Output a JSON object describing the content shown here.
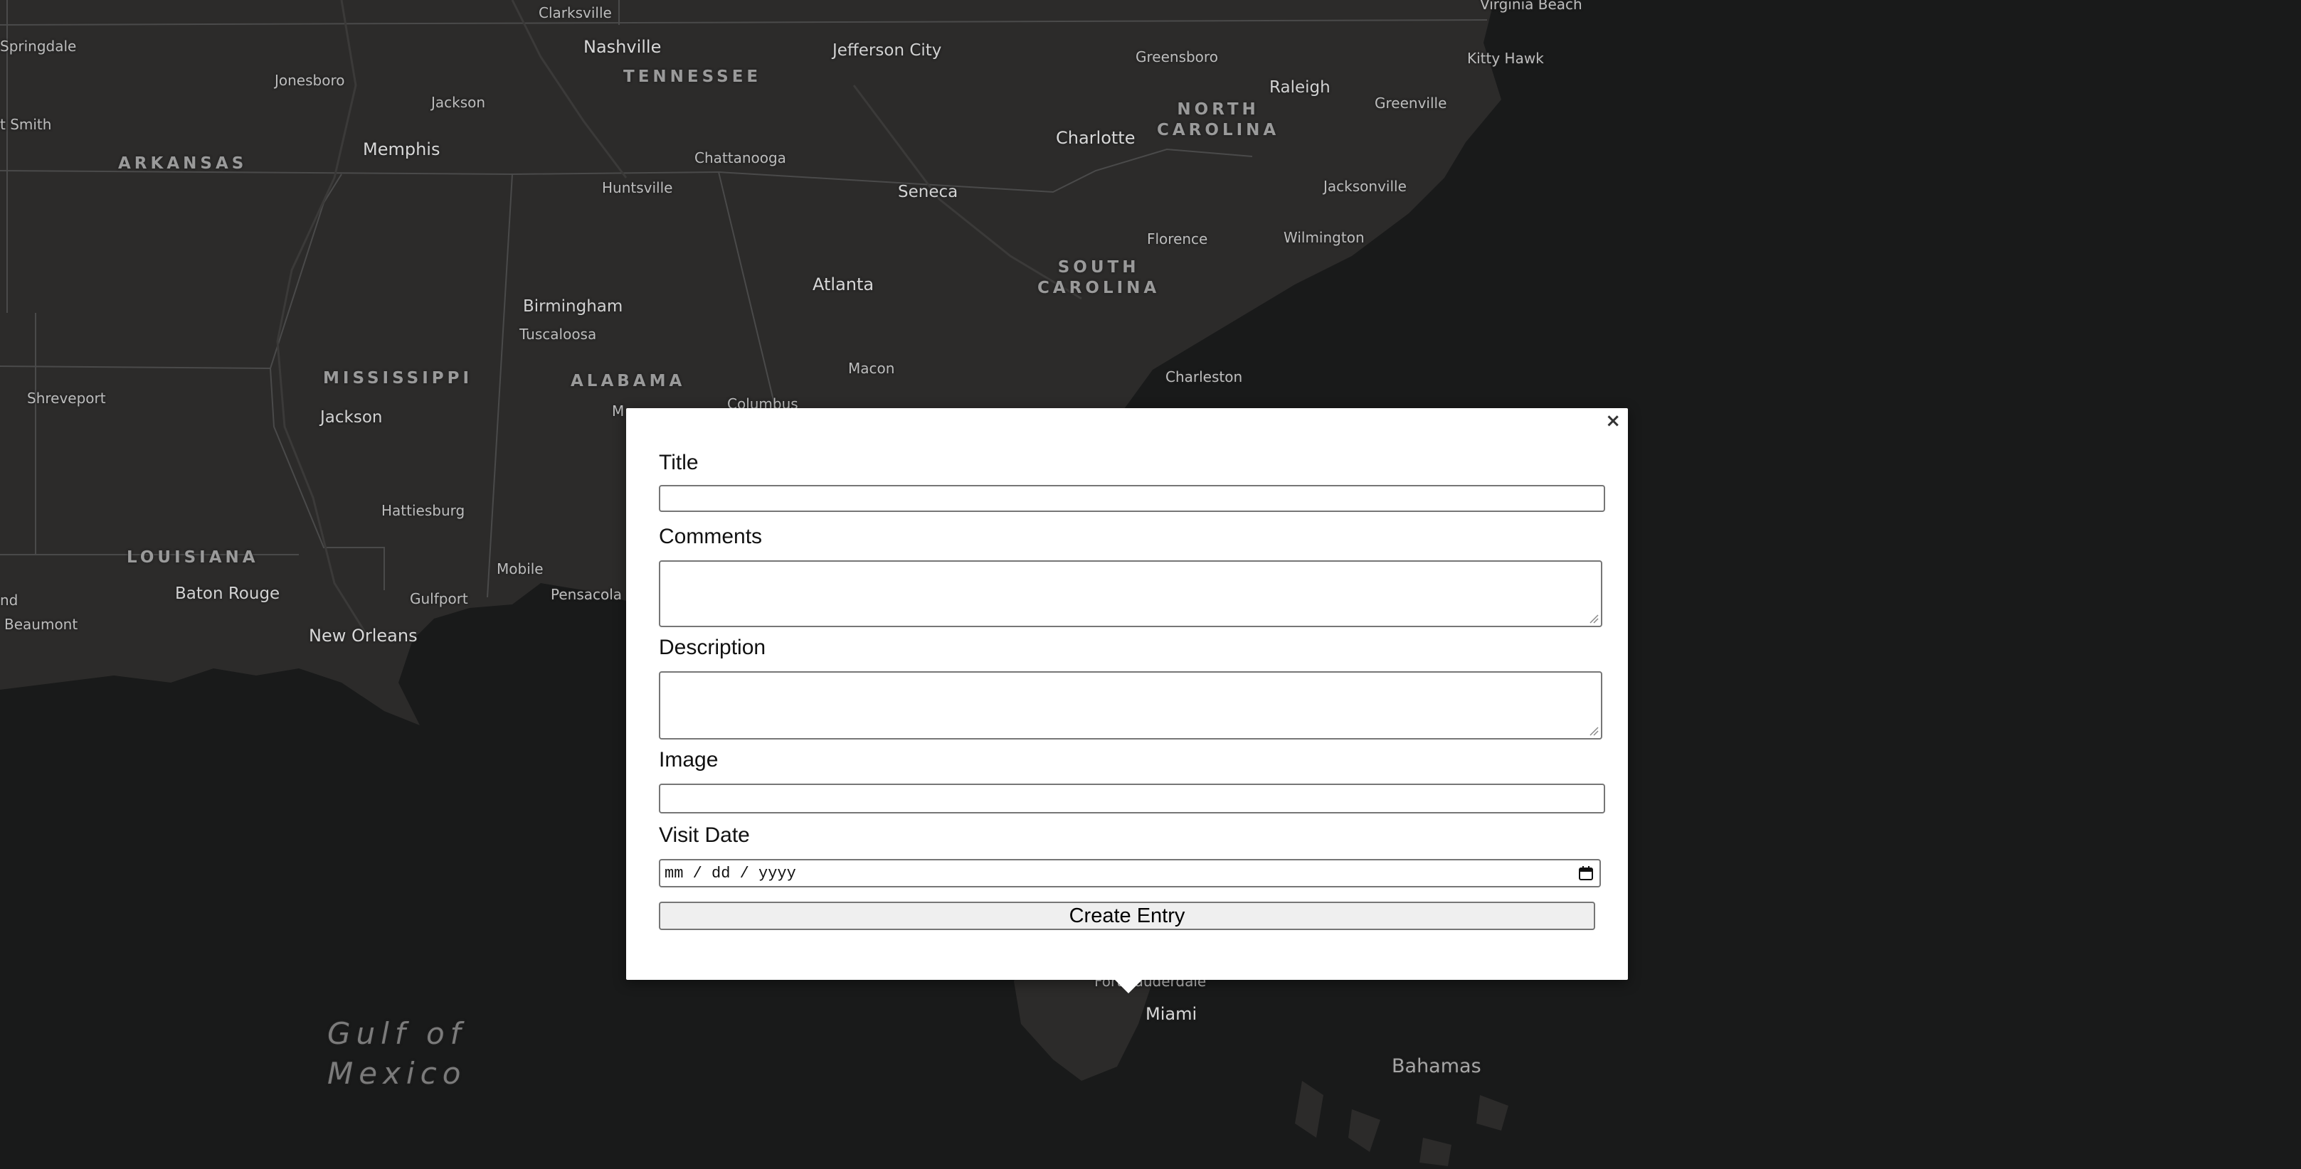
{
  "map": {
    "cities": {
      "clarksville": "Clarksville",
      "nashville": "Nashville",
      "jefferson_city": "Jefferson City",
      "greensboro": "Greensboro",
      "virginia_beach": "Virginia Beach",
      "springdale": "Springdale",
      "jonesboro": "Jonesboro",
      "jackson_tn": "Jackson",
      "kitty_hawk": "Kitty Hawk",
      "raleigh": "Raleigh",
      "greenville": "Greenville",
      "fort_smith": "t Smith",
      "memphis": "Memphis",
      "chattanooga": "Chattanooga",
      "charlotte": "Charlotte",
      "huntsville": "Huntsville",
      "seneca": "Seneca",
      "jacksonville": "Jacksonville",
      "florence": "Florence",
      "wilmington": "Wilmington",
      "atlanta": "Atlanta",
      "birmingham": "Birmingham",
      "tuscaloosa": "Tuscaloosa",
      "macon": "Macon",
      "charleston": "Charleston",
      "shreveport": "Shreveport",
      "jackson_ms": "Jackson",
      "columbus": "Columbus",
      "montgomery_partial": "M",
      "hattiesburg": "Hattiesburg",
      "mobile": "Mobile",
      "baton_rouge": "Baton Rouge",
      "gulfport": "Gulfport",
      "pensacola": "Pensacola",
      "new_orleans": "New Orleans",
      "beaumont": "Beaumont",
      "lake_charles_partial": "nd",
      "fort_lauderdale": "Fort Lauderdale",
      "miami": "Miami"
    },
    "states": {
      "tennessee": "TENNESSEE",
      "arkansas": "ARKANSAS",
      "north_carolina": "NORTH\nCAROLINA",
      "south_carolina": "SOUTH\nCAROLINA",
      "mississippi": "MISSISSIPPI",
      "alabama": "ALABAMA",
      "louisiana": "LOUISIANA"
    },
    "water": {
      "gulf": "Gulf of\nMexico"
    },
    "countries": {
      "bahamas": "Bahamas"
    }
  },
  "popup": {
    "close_label": "×",
    "form": {
      "title_label": "Title",
      "title_value": "",
      "comments_label": "Comments",
      "comments_value": "",
      "description_label": "Description",
      "description_value": "",
      "image_label": "Image",
      "image_value": "",
      "visit_date_label": "Visit Date",
      "visit_date_placeholder": "mm / dd / yyyy",
      "submit_label": "Create Entry"
    }
  },
  "colors": {
    "water": "#191a1a",
    "land": "#2c2b2a",
    "border": "#4a4a4a",
    "popup_bg": "#ffffff"
  }
}
